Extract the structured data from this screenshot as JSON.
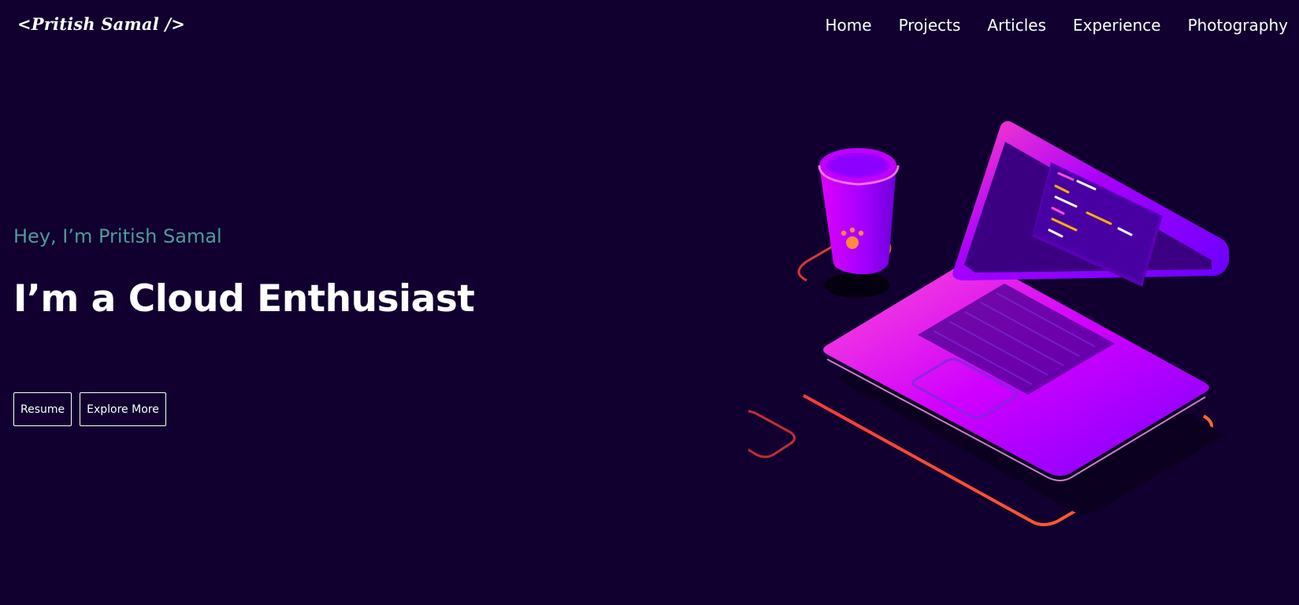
{
  "header": {
    "logo": "<Pritish Samal />",
    "nav": [
      "Home",
      "Projects",
      "Articles",
      "Experience",
      "Photography"
    ]
  },
  "hero": {
    "greeting": "Hey, I’m Pritish Samal",
    "headline": "I’m a Cloud Enthusiast",
    "buttons": {
      "resume": "Resume",
      "explore": "Explore More"
    }
  },
  "illustration": {
    "name": "isometric-laptop-and-coffee-cup-icon"
  },
  "colors": {
    "background": "#11002f",
    "accent_teal": "#4f9a9a",
    "text": "#ffffff",
    "neon_magenta": "#d000ff",
    "neon_red": "#ff3b3b"
  }
}
